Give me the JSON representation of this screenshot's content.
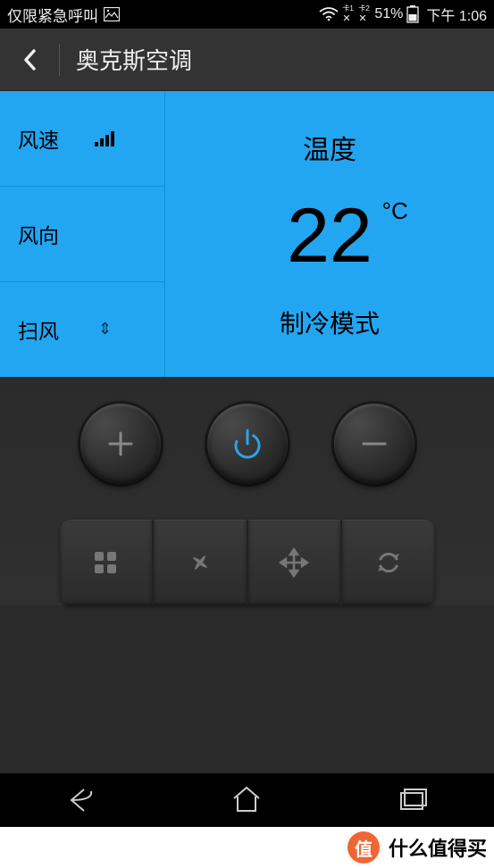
{
  "status": {
    "carrier": "仅限紧急呼叫",
    "battery_pct": "51%",
    "time": "下午 1:06",
    "sim1": "卡1",
    "sim2": "卡2"
  },
  "header": {
    "title": "奥克斯空调"
  },
  "left_menu": {
    "fan_speed": "风速",
    "fan_dir": "风向",
    "swing": "扫风"
  },
  "panel": {
    "temp_label": "温度",
    "temp_value": "22",
    "temp_unit": "°C",
    "mode": "制冷模式"
  },
  "icons": {
    "back": "back-icon",
    "gallery": "gallery-icon",
    "wifi": "wifi-icon",
    "battery": "battery-icon",
    "plus": "plus-icon",
    "power": "power-icon",
    "minus": "minus-icon",
    "grid": "grid-icon",
    "fan": "fan-icon",
    "move": "move-icon",
    "sync": "sync-icon",
    "nav_back": "nav-back-icon",
    "nav_home": "nav-home-icon",
    "nav_recent": "nav-recent-icon"
  },
  "watermark": {
    "seal": "值",
    "text": "什么值得买"
  }
}
